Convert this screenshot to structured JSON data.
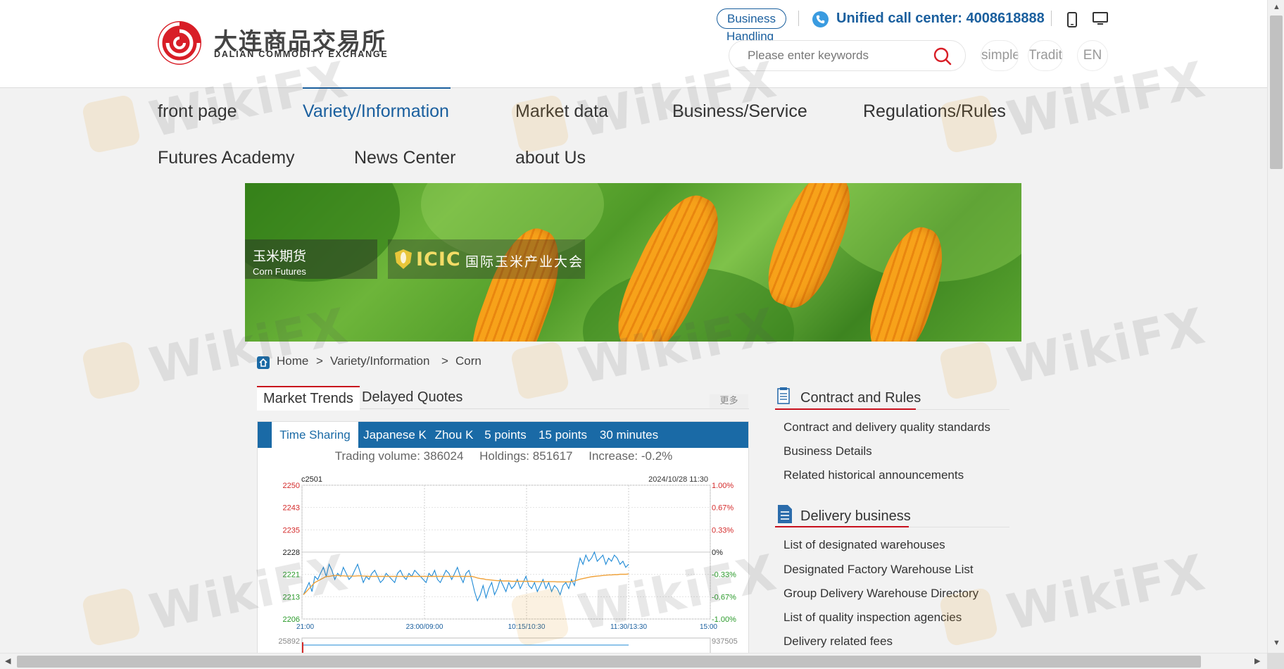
{
  "header": {
    "logo_cn": "大连商品交易所",
    "logo_en": "DALIAN COMMODITY EXCHANGE",
    "business_btn": "Business",
    "business_sub": "Handling",
    "hotline": "Unified call center: 4008618888",
    "search_placeholder": "Please enter keywords",
    "lang": {
      "simple": "simple",
      "traditional": "Traditional",
      "en": "EN"
    }
  },
  "nav": {
    "front_page": "front page",
    "variety": "Variety/Information",
    "market_data": "Market data",
    "business_service": "Business/Service",
    "regulations": "Regulations/Rules",
    "futures_academy": "Futures Academy",
    "news_center": "News Center",
    "about_us": "about Us"
  },
  "banner": {
    "tag_cn": "玉米期货",
    "tag_en": "Corn Futures",
    "icic": "ICIC",
    "icic_cn": "国际玉米产业大会"
  },
  "breadcrumb": {
    "home": "Home",
    "sep": ">",
    "level1": "Variety/Information",
    "level2": "Corn"
  },
  "tabs": {
    "market_trends": "Market Trends",
    "delayed_quotes": "Delayed Quotes",
    "more": "更多"
  },
  "subtabs": {
    "time_sharing": "Time Sharing",
    "japanese_k": "Japanese K",
    "zhou_k": "Zhou K",
    "five_points": "5 points",
    "fifteen_points": "15 points",
    "thirty_minutes": "30 minutes"
  },
  "stats": {
    "volume": "Trading volume: 386024",
    "holdings": "Holdings: 851617",
    "increase": "Increase: -0.2%"
  },
  "chart_data": {
    "type": "line",
    "title": "c2501",
    "timestamp": "2024/10/28 11:30",
    "y_left_ticks": [
      "2250",
      "2243",
      "2235",
      "2228",
      "2221",
      "2213",
      "2206"
    ],
    "y_right_ticks": [
      "1.00%",
      "0.67%",
      "0.33%",
      "0%",
      "-0.33%",
      "-0.67%",
      "-1.00%"
    ],
    "x_ticks": [
      "21:00",
      "23:00/09:00",
      "10:15/10:30",
      "11:30/13:30",
      "15:00"
    ],
    "ylim": [
      2206,
      2250
    ],
    "baseline": 2228,
    "volume_left_label": "25892",
    "volume_right_label": "937505",
    "series": [
      {
        "values": [
          2214,
          2216,
          2218,
          2215,
          2220,
          2219,
          2221,
          2223,
          2220,
          2224,
          2222,
          2219,
          2221,
          2220,
          2223,
          2221,
          2219,
          2220,
          2222,
          2224,
          2221,
          2218,
          2220,
          2219,
          2221,
          2222,
          2220,
          2218,
          2219,
          2221,
          2220,
          2219,
          2218,
          2221,
          2222,
          2220,
          2219,
          2221,
          2220,
          2222,
          2221,
          2220,
          2219,
          2218,
          2221,
          2220,
          2222,
          2219,
          2218,
          2220,
          2222,
          2221,
          2219,
          2221,
          2223,
          2220,
          2218,
          2221,
          2222,
          2219,
          2215,
          2212,
          2214,
          2217,
          2213,
          2216,
          2218,
          2214,
          2216,
          2219,
          2217,
          2215,
          2218,
          2216,
          2217,
          2219,
          2216,
          2218,
          2220,
          2217,
          2216,
          2218,
          2215,
          2217,
          2219,
          2216,
          2218,
          2215,
          2217,
          2216,
          2214,
          2217,
          2218,
          2216,
          2219,
          2217,
          2222,
          2226,
          2224,
          2227,
          2225,
          2226,
          2228,
          2225,
          2226,
          2227,
          2224,
          2226,
          2225,
          2227,
          2226,
          2224,
          2225,
          2223,
          2224
        ]
      },
      {
        "values": [
          2214,
          2215,
          2216,
          2217,
          2218,
          2218.5,
          2219,
          2219.5,
          2220,
          2220,
          2220.2,
          2220.3,
          2220.3,
          2220.2,
          2220.2,
          2220.1,
          2220.1,
          2220.1,
          2220.1,
          2220.2,
          2220.2,
          2220.1,
          2220.1,
          2220,
          2220,
          2220,
          2220,
          2220,
          2220,
          2220,
          2220,
          2220,
          2220,
          2220,
          2220,
          2220,
          2220,
          2220,
          2220,
          2220,
          2220,
          2220,
          2220,
          2220,
          2220,
          2220,
          2220,
          2220,
          2220,
          2220,
          2220,
          2220,
          2220,
          2220,
          2220,
          2220,
          2220,
          2220,
          2220,
          2220,
          2219.8,
          2219.5,
          2219.3,
          2219.2,
          2219,
          2218.9,
          2218.8,
          2218.7,
          2218.6,
          2218.6,
          2218.5,
          2218.5,
          2218.5,
          2218.4,
          2218.4,
          2218.4,
          2218.4,
          2218.4,
          2218.4,
          2218.4,
          2218.4,
          2218.3,
          2218.3,
          2218.3,
          2218.3,
          2218.3,
          2218.3,
          2218.3,
          2218.3,
          2218.2,
          2218.2,
          2218.2,
          2218.2,
          2218.2,
          2218.3,
          2218.5,
          2218.8,
          2219.1,
          2219.3,
          2219.5,
          2219.7,
          2219.9,
          2220,
          2220.1,
          2220.2,
          2220.3,
          2220.4,
          2220.5,
          2220.5,
          2220.6,
          2220.6,
          2220.7,
          2220.7,
          2220.7,
          2220.8
        ]
      }
    ]
  },
  "side": {
    "contract_title": "Contract and Rules",
    "contract_links": [
      "Contract and delivery quality standards",
      "Business Details",
      "Related historical announcements"
    ],
    "delivery_title": "Delivery business",
    "delivery_links": [
      "List of designated warehouses",
      "Designated Factory Warehouse List",
      "Group Delivery Warehouse Directory",
      "List of quality inspection agencies",
      "Delivery related fees"
    ]
  },
  "watermark": "WikiFX",
  "colors": {
    "brand_blue": "#1a5f9e",
    "accent_red": "#c8101d",
    "tab_blue": "#1a6aa6"
  }
}
